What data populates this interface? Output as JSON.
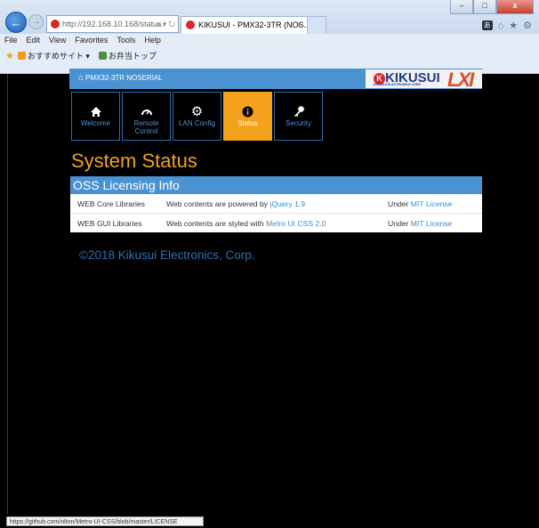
{
  "browser": {
    "address": "http://192.168.10.168/status.l",
    "tab_title": "KIKUSUI - PMX32-3TR (NOS...",
    "tab_close": "×",
    "menu": [
      "File",
      "Edit",
      "View",
      "Favorites",
      "Tools",
      "Help"
    ],
    "favorites": [
      "おすすめサイト ▾",
      "お弁当トップ"
    ],
    "status_url": "https://github.com/olton/Metro-UI-CSS/blob/master/LICENSE"
  },
  "header": {
    "device_title": "PMX32-3TR NOSERIAL",
    "kikusui_logo": "KIKUSUI",
    "kikusui_sub": "KIKUSUI ELECTRONICS CORP.",
    "lxi_logo": "LXI"
  },
  "nav_tiles": [
    {
      "label": "Welcome",
      "icon": "home-icon",
      "active": false
    },
    {
      "label": "Remote Control",
      "icon": "gauge-icon",
      "active": false
    },
    {
      "label": "LAN Config",
      "icon": "gear-icon",
      "active": false
    },
    {
      "label": "Status",
      "icon": "info-icon",
      "active": true
    },
    {
      "label": "Security",
      "icon": "key-icon",
      "active": false
    }
  ],
  "page_title": "System Status",
  "panel": {
    "title": "OSS Licensing Info",
    "rows": [
      {
        "name": "WEB Core Libraries",
        "desc_prefix": "Web contents are powered by ",
        "desc_link": "jQuery 1.9",
        "license_prefix": "Under ",
        "license_link": "MIT License"
      },
      {
        "name": "WEB GUI Libraries",
        "desc_prefix": "Web contents are styled with ",
        "desc_link": "Metro UI CSS 2.0",
        "license_prefix": "Under ",
        "license_link": "MIT License"
      }
    ]
  },
  "footer": "©2018 Kikusui Electronics, Corp.",
  "colors": {
    "accent_orange": "#f4a11c",
    "header_blue": "#4a92d2",
    "link_blue": "#3a8ed6"
  }
}
